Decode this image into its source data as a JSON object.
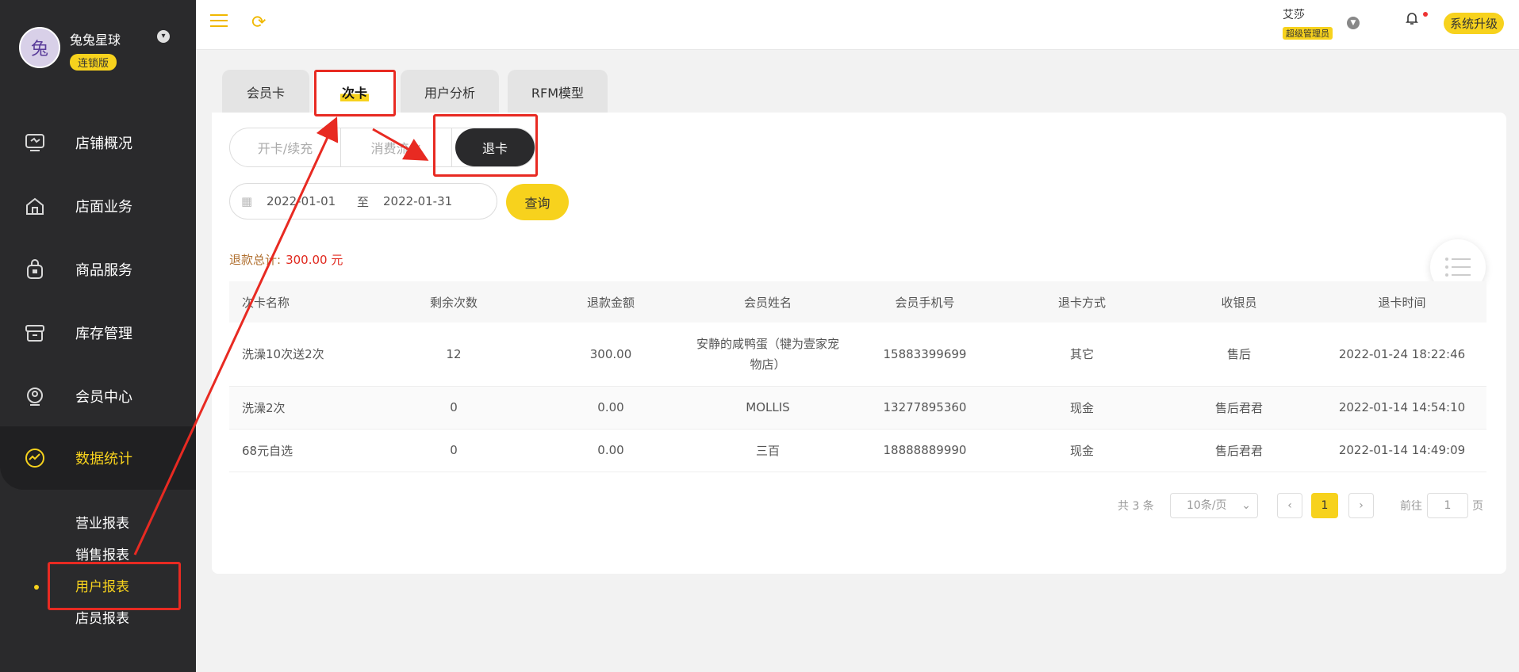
{
  "brand": {
    "name": "兔兔星球",
    "badge": "连锁版",
    "avatar_text": "兔"
  },
  "sidebar": {
    "items": [
      {
        "label": "店铺概况",
        "icon": "monitor-icon"
      },
      {
        "label": "店面业务",
        "icon": "home-icon"
      },
      {
        "label": "商品服务",
        "icon": "bag-icon"
      },
      {
        "label": "库存管理",
        "icon": "box-icon"
      },
      {
        "label": "会员中心",
        "icon": "member-icon"
      },
      {
        "label": "数据统计",
        "icon": "chart-icon"
      }
    ],
    "sub_items": [
      {
        "label": "营业报表"
      },
      {
        "label": "销售报表"
      },
      {
        "label": "用户报表"
      },
      {
        "label": "店员报表"
      }
    ]
  },
  "header": {
    "user_name": "艾莎",
    "user_role": "超级管理员",
    "upgrade_label": "系统升级"
  },
  "tabs": [
    {
      "label": "会员卡"
    },
    {
      "label": "次卡"
    },
    {
      "label": "用户分析"
    },
    {
      "label": "RFM模型"
    }
  ],
  "segments": [
    {
      "label": "开卡/续充"
    },
    {
      "label": "消费流水"
    },
    {
      "label": "退卡"
    }
  ],
  "filter": {
    "start_date": "2022-01-01",
    "to_label": "至",
    "end_date": "2022-01-31",
    "query_label": "查询"
  },
  "summary": {
    "label": "退款总计:",
    "amount": "300.00 元"
  },
  "table": {
    "headers": [
      "次卡名称",
      "剩余次数",
      "退款金额",
      "会员姓名",
      "会员手机号",
      "退卡方式",
      "收银员",
      "退卡时间"
    ],
    "rows": [
      [
        "洗澡10次送2次",
        "12",
        "300.00",
        "安静的咸鸭蛋（犍为壹家宠物店）",
        "15883399699",
        "其它",
        "售后",
        "2022-01-24 18:22:46"
      ],
      [
        "洗澡2次",
        "0",
        "0.00",
        "MOLLIS",
        "13277895360",
        "现金",
        "售后君君",
        "2022-01-14 14:54:10"
      ],
      [
        "68元自选",
        "0",
        "0.00",
        "三百",
        "18888889990",
        "现金",
        "售后君君",
        "2022-01-14 14:49:09"
      ]
    ]
  },
  "pagination": {
    "total": "共 3 条",
    "page_size": "10条/页",
    "current": "1",
    "goto_label": "前往",
    "goto_value": "1",
    "page_label": "页"
  },
  "colors": {
    "accent": "#f7d21d",
    "sidebar": "#2a2a2c",
    "annotation": "#e82a22"
  }
}
